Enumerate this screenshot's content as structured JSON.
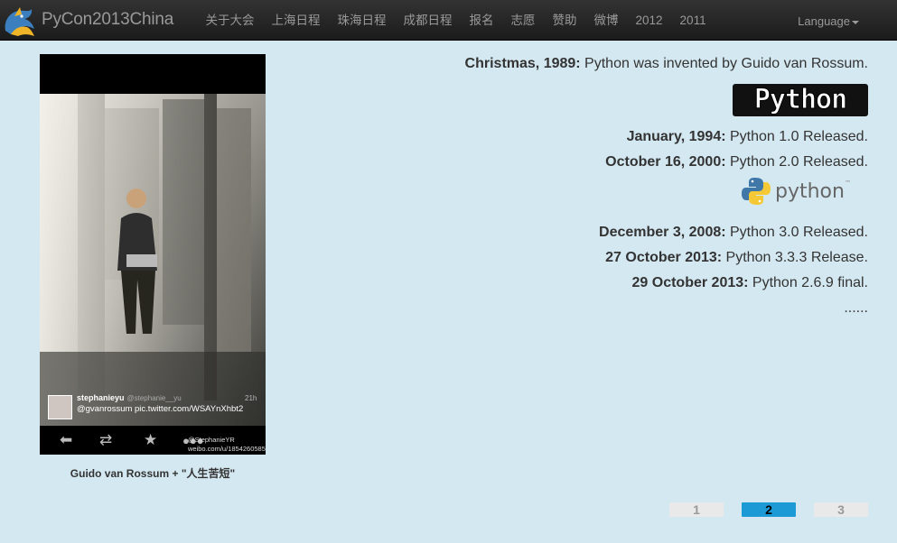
{
  "header": {
    "brand": "PyCon2013China",
    "nav_items": [
      "关于大会",
      "上海日程",
      "珠海日程",
      "成都日程",
      "报名",
      "志愿",
      "赞助",
      "微博",
      "2012",
      "2011"
    ],
    "language_label": "Language"
  },
  "photo": {
    "caption": "Guido van Rossum + \"人生苦短\"",
    "tweet_user": "stephanieyu",
    "tweet_handle": "@stephanie__yu",
    "tweet_time": "21h",
    "tweet_text": "@gvanrossum pic.twitter.com/WSAYnXhbt2",
    "watermark_handle": "@StephanieYR",
    "watermark_url": "weibo.com/u/1854260585"
  },
  "timeline": {
    "entries": [
      {
        "date": "Christmas, 1989:",
        "text": " Python was invented by Guido van Rossum."
      },
      {
        "date": "January, 1994:",
        "text": " Python 1.0 Released."
      },
      {
        "date": "October 16, 2000:",
        "text": " Python 2.0 Released."
      },
      {
        "date": "December 3, 2008:",
        "text": " Python 3.0 Released."
      },
      {
        "date": "27 October 2013:",
        "text": " Python 3.3.3 Release."
      },
      {
        "date": "29 October 2013:",
        "text": " Python 2.6.9 final."
      }
    ],
    "ellipsis": "......",
    "old_logo_text": "Python",
    "new_logo_text": "python",
    "new_logo_tm": "™"
  },
  "pagination": {
    "pages": [
      "1",
      "2",
      "3"
    ],
    "current": "2"
  },
  "colors": {
    "background": "#d4e8f1",
    "navbar": "#222222",
    "active_page": "#1b9ad5"
  }
}
